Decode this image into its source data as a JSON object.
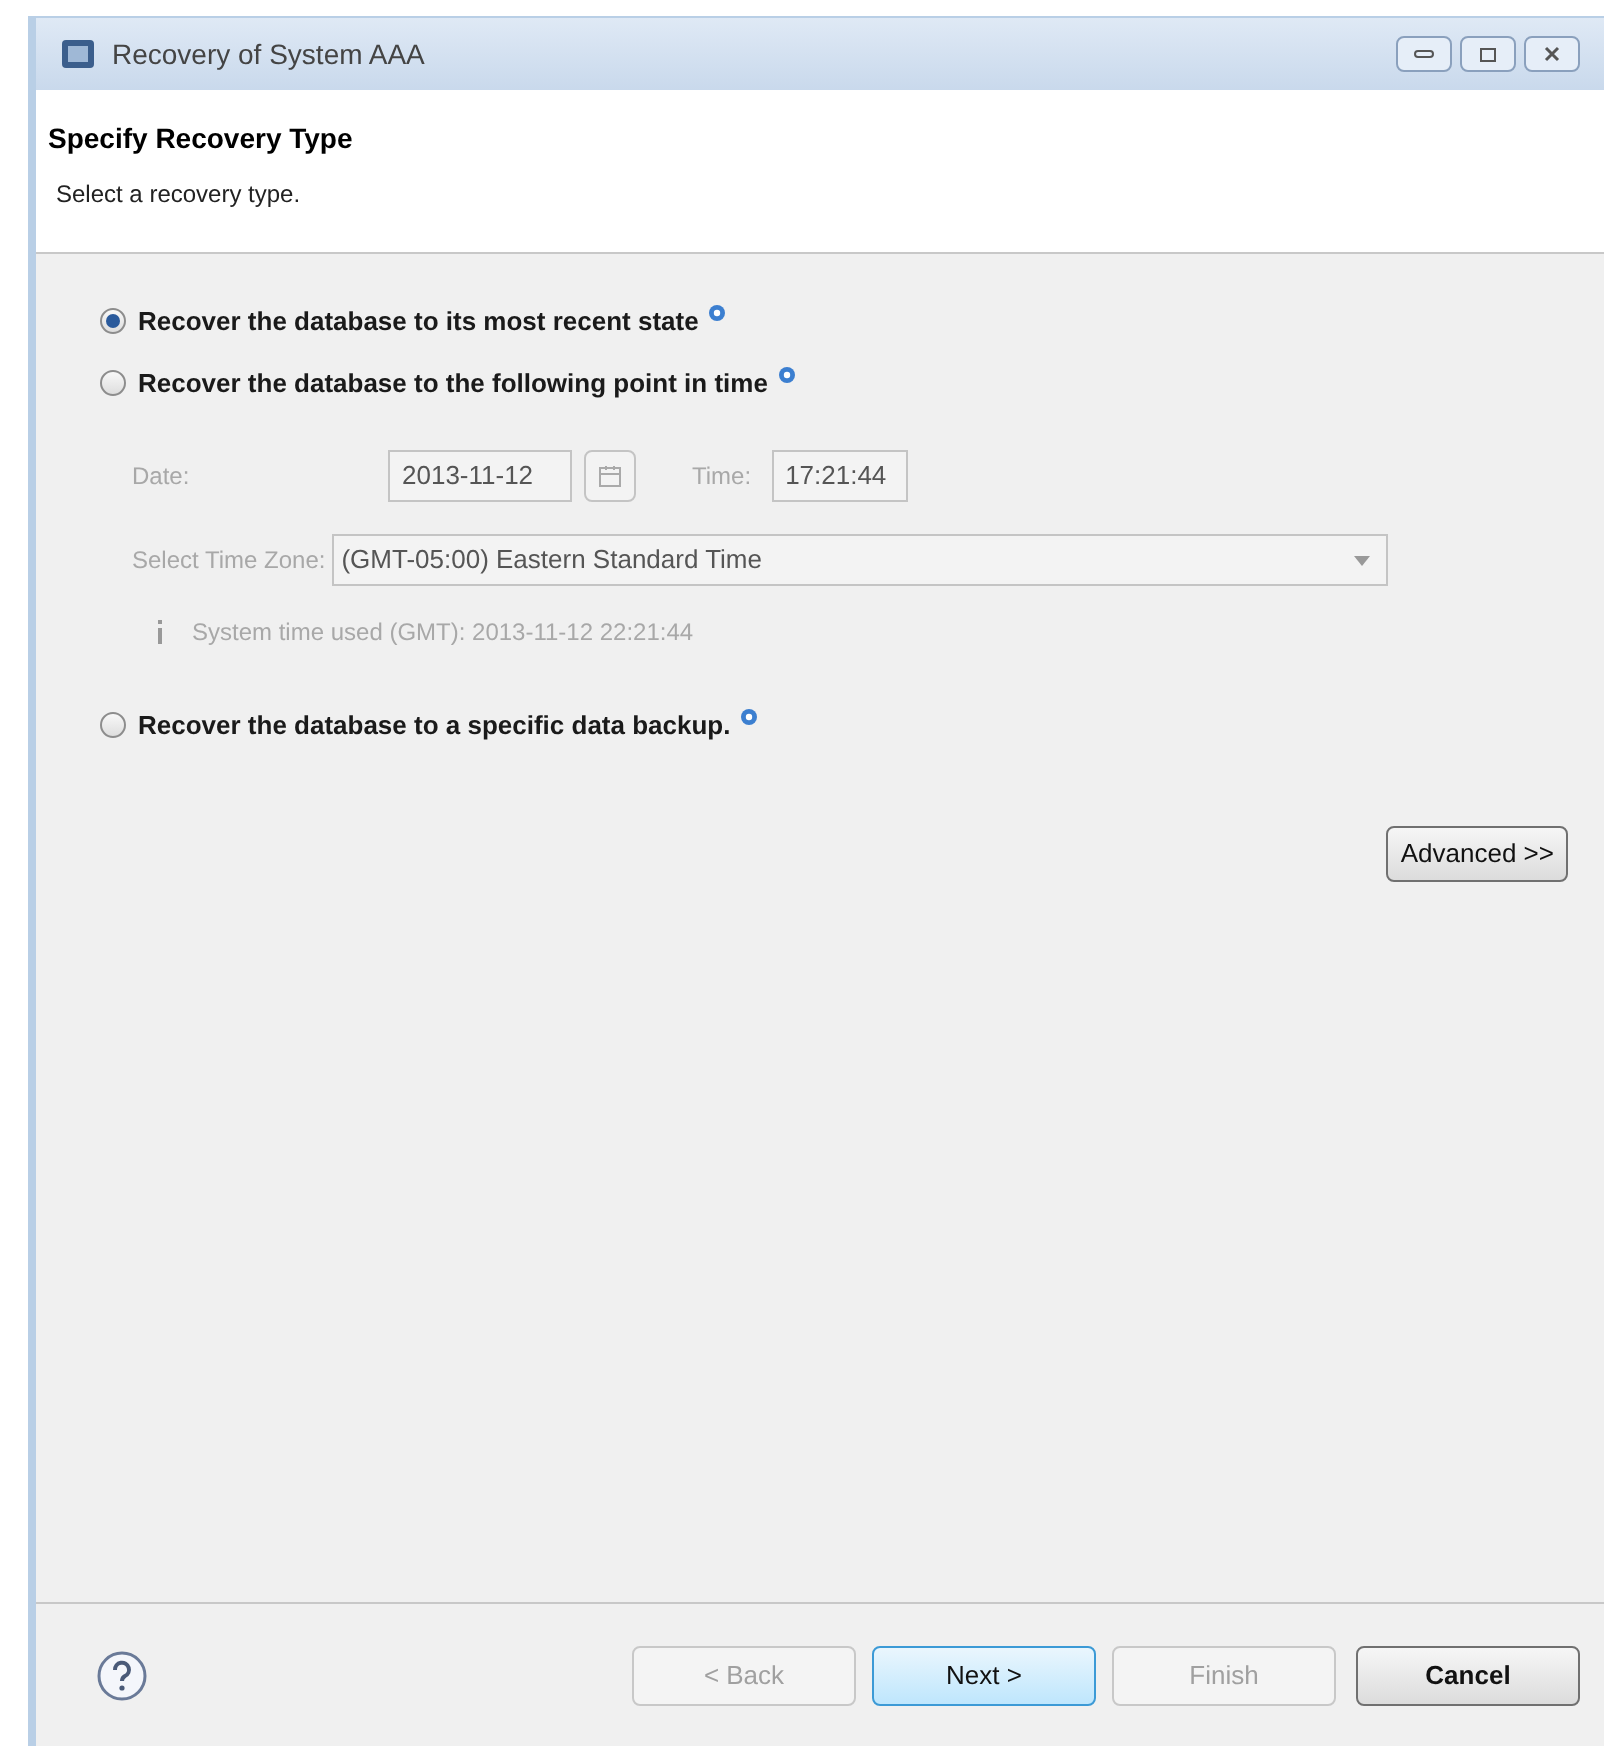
{
  "window": {
    "title": "Recovery of System AAA"
  },
  "header": {
    "title": "Specify Recovery Type",
    "subtitle": "Select a recovery type."
  },
  "options": [
    {
      "label": "Recover the database to its most recent state",
      "selected": true
    },
    {
      "label": "Recover the database to the following point in time",
      "selected": false
    },
    {
      "label": "Recover the database to a specific data backup.",
      "selected": false
    }
  ],
  "point_in_time": {
    "disabled": true,
    "date_label": "Date:",
    "date": "2013-11-12",
    "time_label": "Time:",
    "time": "17:21:44",
    "timezone_label": "Select Time Zone:",
    "timezone": "(GMT-05:00) Eastern Standard Time",
    "note": "System time used (GMT): 2013-11-12 22:21:44"
  },
  "advanced_button": "Advanced >>",
  "buttons": [
    {
      "label": "< Back",
      "disabled": true,
      "default": false
    },
    {
      "label": "Next >",
      "disabled": false,
      "default": true
    },
    {
      "label": "Finish",
      "disabled": true,
      "default": false
    },
    {
      "label": "Cancel",
      "disabled": false,
      "default": false
    }
  ]
}
